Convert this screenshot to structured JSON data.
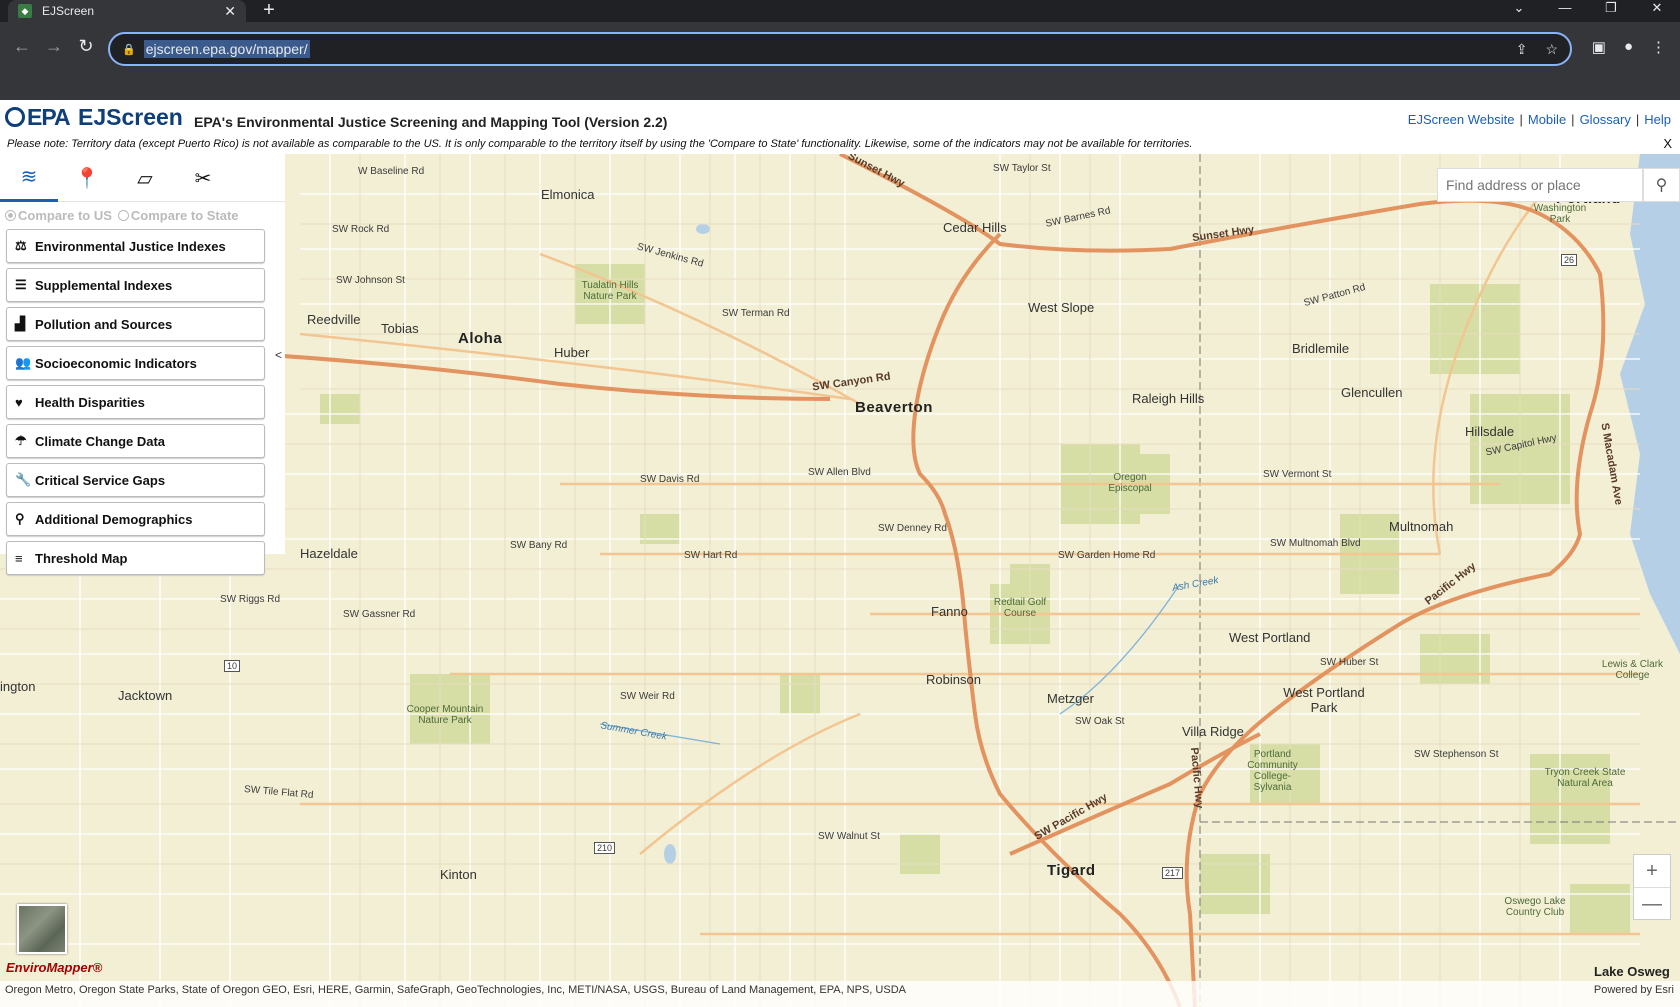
{
  "browser": {
    "tab_title": "EJScreen",
    "tab_favicon": "epa-favicon",
    "new_tab": "+",
    "url": "ejscreen.epa.gov/mapper/",
    "window_controls": [
      "⌄",
      "—",
      "❐",
      "✕"
    ]
  },
  "header": {
    "logo_text": "EPA",
    "app_name": "EJScreen",
    "subtitle": "EPA's Environmental Justice Screening and Mapping Tool (Version 2.2)",
    "links": [
      "EJScreen Website",
      "Mobile",
      "Glossary",
      "Help"
    ],
    "notice": "Please note: Territory data (except Puerto Rico) is not available as comparable to the US. It is only comparable to the territory itself by using the 'Compare to State' functionality. Likewise, some of the indicators may not be available for territories.",
    "notice_close": "X"
  },
  "panel": {
    "tabs": [
      "layers-icon",
      "location-pin-icon",
      "notes-icon",
      "tools-icon"
    ],
    "compare": {
      "us": "Compare to US",
      "state": "Compare to State"
    },
    "collapse": "<",
    "menu": [
      {
        "label": "Environmental Justice Indexes",
        "icon": "scales-icon",
        "glyph": "⚖"
      },
      {
        "label": "Supplemental Indexes",
        "icon": "list-icon",
        "glyph": "☰"
      },
      {
        "label": "Pollution and Sources",
        "icon": "factory-icon",
        "glyph": "▟"
      },
      {
        "label": "Socioeconomic Indicators",
        "icon": "people-icon",
        "glyph": "👥"
      },
      {
        "label": "Health Disparities",
        "icon": "heart-icon",
        "glyph": "♥"
      },
      {
        "label": "Climate Change Data",
        "icon": "climate-icon",
        "glyph": "☂"
      },
      {
        "label": "Critical Service Gaps",
        "icon": "wrench-icon",
        "glyph": "🔧"
      },
      {
        "label": "Additional Demographics",
        "icon": "demographics-icon",
        "glyph": "⚲"
      },
      {
        "label": "Threshold Map",
        "icon": "sliders-icon",
        "glyph": "≡"
      }
    ]
  },
  "map": {
    "search_placeholder": "Find address or place",
    "zoom_in": "+",
    "zoom_out": "—",
    "brand": "EnviroMapper®",
    "attribution": "Oregon Metro, Oregon State Parks, State of Oregon GEO, Esri, HERE, Garmin, SafeGraph, GeoTechnologies, Inc, METI/NASA, USGS, Bureau of Land Management, EPA, NPS, USDA",
    "powered_by": "Powered by Esri",
    "corner_label": "Lake Osweg",
    "places": {
      "portland": "Portland",
      "beaverton": "Beaverton",
      "aloha": "Aloha",
      "tigard": "Tigard",
      "cedar_hills": "Cedar Hills",
      "west_slope": "West Slope",
      "raleigh_hills": "Raleigh Hills",
      "bridlemile": "Bridlemile",
      "glencullen": "Glencullen",
      "hillsdale": "Hillsdale",
      "multnomah": "Multnomah",
      "west_portland": "West Portland",
      "west_portland_park": "West Portland Park",
      "villa_ridge": "Villa Ridge",
      "metzger": "Metzger",
      "robinson": "Robinson",
      "fanno": "Fanno",
      "huber": "Huber",
      "tobias": "Tobias",
      "reedville": "Reedville",
      "elmonica": "Elmonica",
      "hazeldale": "Hazeldale",
      "jacktown": "Jacktown",
      "kinton": "Kinton",
      "ington": "ington"
    },
    "parks": {
      "tualatin_hills": "Tualatin Hills Nature Park",
      "cooper_mountain": "Cooper Mountain Nature Park",
      "oregon_episcopal": "Oregon Episcopal",
      "redtail": "Redtail Golf Course",
      "pcc": "Portland Community College-Sylvania",
      "tryon": "Tryon Creek State Natural Area",
      "lewis_clark": "Lewis & Clark College",
      "washington_park": "Washington Park",
      "oswego": "Oswego Lake Country Club"
    },
    "roads": {
      "sunset_hwy_1": "Sunset Hwy",
      "sunset_hwy_2": "Sunset Hwy",
      "canyon": "SW Canyon Rd",
      "pacific_hwy": "SW Pacific Hwy",
      "pacific_hwy_2": "Pacific Hwy",
      "pacific_hwy_3": "Pacific Hwy",
      "macadam": "S Macadam Ave",
      "allen": "SW Allen Blvd",
      "denney": "SW Denney Rd",
      "hart": "SW Hart Rd",
      "davis": "SW Davis Rd",
      "bany": "SW Bany Rd",
      "weir": "SW Weir Rd",
      "baseline": "W Baseline Rd",
      "tv_hwy": "SW Jenkins Rd",
      "garden_home": "SW Garden Home Rd",
      "multnomah_blvd": "SW Multnomah Blvd",
      "vermont": "SW Vermont St",
      "capitol": "SW Capitol Hwy",
      "ash_creek": "Ash Creek",
      "summer_creek": "Summer Creek",
      "johnson": "SW Johnson St",
      "rock": "SW Rock Rd",
      "riggs": "SW Riggs Rd",
      "gassner": "SW Gassner Rd",
      "tile_flat": "SW Tile Flat Rd",
      "walnut": "SW Walnut St",
      "oak": "SW Oak St",
      "huber_st": "SW Huber St",
      "stephenson": "SW Stephenson St",
      "barnes": "SW Barnes Rd",
      "patton": "SW Patton Rd",
      "taylor": "SW Taylor St",
      "jenkins": "SW Jenkins Rd",
      "terman": "SW Terman Rd"
    },
    "shields": {
      "r26": "26",
      "r10": "10",
      "r210": "210",
      "r217": "217"
    }
  }
}
